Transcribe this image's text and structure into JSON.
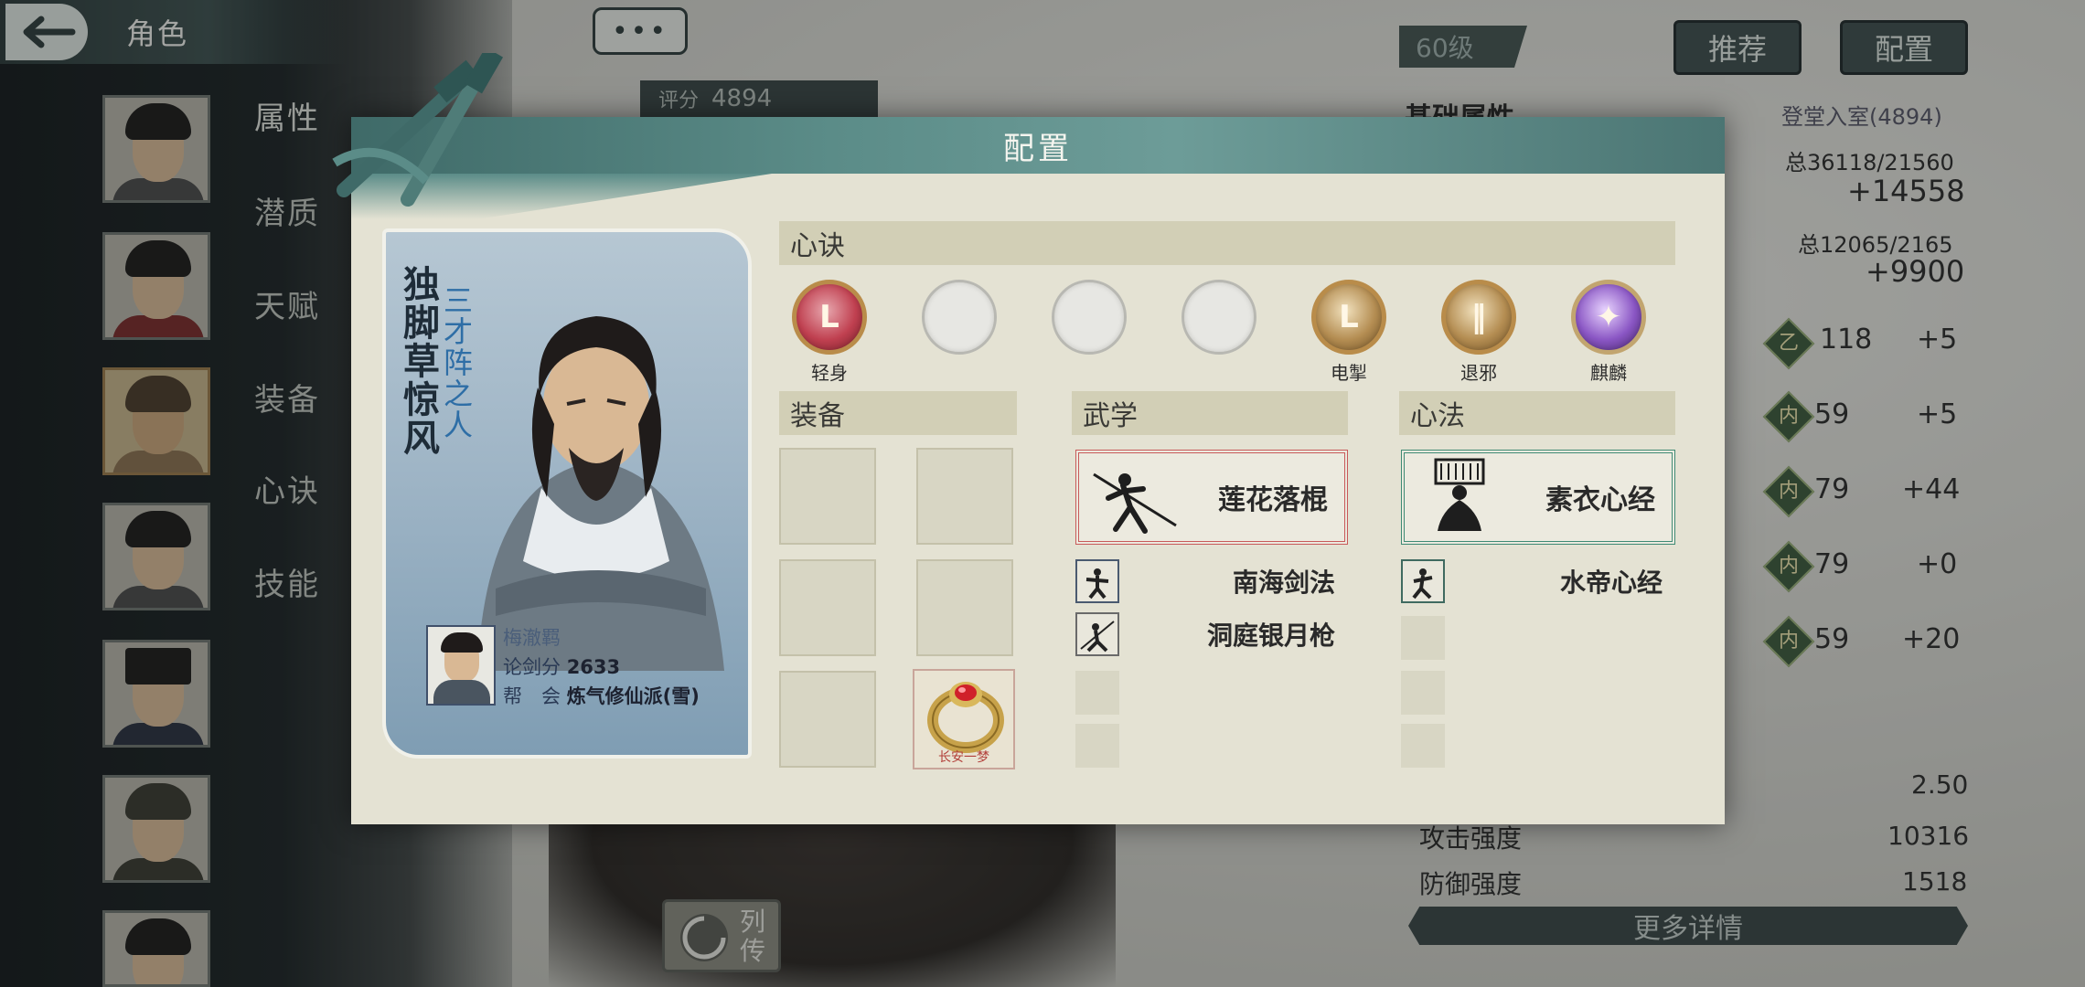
{
  "header": {
    "title": "角色",
    "chat_dots": "•••"
  },
  "sidebar": {
    "tabs": [
      "属性",
      "潜质",
      "天赋",
      "装备",
      "心诀",
      "技能"
    ]
  },
  "topbar": {
    "level": "60级",
    "recommend_label": "推荐",
    "config_label": "配置",
    "score_label": "评分",
    "score_value": "4894"
  },
  "right_panel": {
    "heading": "基础属性",
    "rank": "登堂入室(4894)",
    "total1": "总36118/21560",
    "bonus1": "+14558",
    "total2": "总12065/2165",
    "bonus2": "+9900",
    "rows": [
      {
        "badge": "乙",
        "value": "118",
        "delta": "+5"
      },
      {
        "badge": "内",
        "value": "59",
        "delta": "+5"
      },
      {
        "badge": "内",
        "value": "79",
        "delta": "+44"
      },
      {
        "badge": "内",
        "value": "79",
        "delta": "+0"
      },
      {
        "badge": "内",
        "value": "59",
        "delta": "+20"
      }
    ],
    "value_a": "2.50",
    "attack_label": "攻击强度",
    "attack_value": "10316",
    "defense_label": "防御强度",
    "defense_value": "1518",
    "more_details": "更多详情",
    "biography": "列传"
  },
  "modal": {
    "title": "配置",
    "character": {
      "nickname": "独脚草惊风",
      "title": "三才阵之人",
      "name": "梅澈羁",
      "sword_score_label": "论剑分",
      "sword_score": "2633",
      "guild_label": "帮　会",
      "guild": "炼气修仙派(雪)"
    },
    "xinjue": {
      "label": "心诀",
      "skills": [
        {
          "name": "轻身",
          "style": "red"
        },
        {
          "name": "",
          "style": "empty"
        },
        {
          "name": "",
          "style": "empty"
        },
        {
          "name": "",
          "style": "empty"
        },
        {
          "name": "电掣",
          "style": "bronze"
        },
        {
          "name": "退邪",
          "style": "bronze"
        },
        {
          "name": "麒麟",
          "style": "purple"
        }
      ]
    },
    "equipment": {
      "label": "装备",
      "ring_caption": "长安一梦"
    },
    "martial": {
      "label": "武学",
      "main": "莲花落棍",
      "subs": [
        "南海剑法",
        "洞庭银月枪"
      ]
    },
    "mind": {
      "label": "心法",
      "main": "素衣心经",
      "subs": [
        "水帝心经"
      ]
    }
  },
  "colors": {
    "modal_header": "#5b8c88",
    "section_bar": "#d2cfb6",
    "martial_border": "#c85a5a",
    "mind_border": "#3f8a74"
  }
}
